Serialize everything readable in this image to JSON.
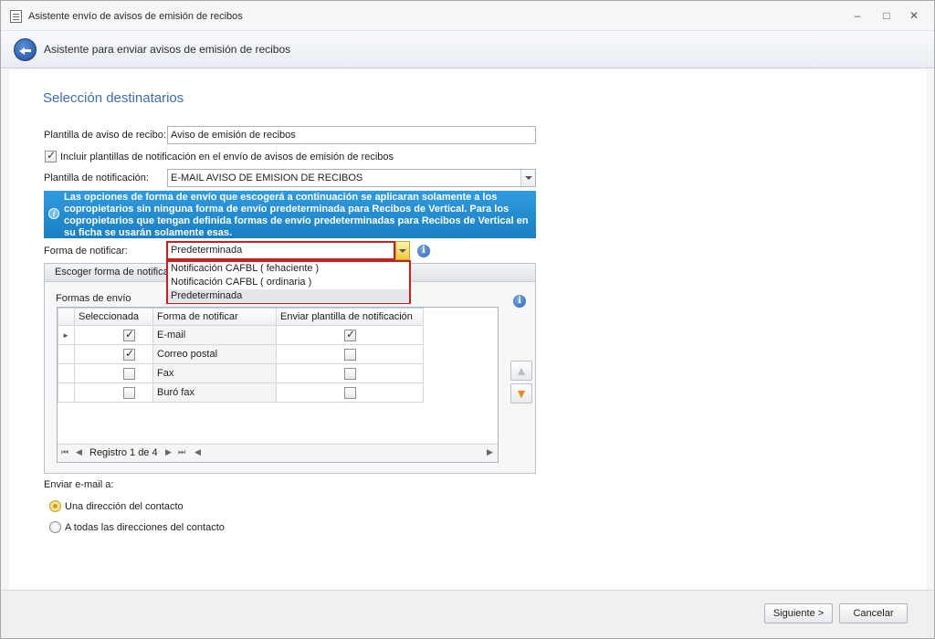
{
  "window": {
    "title": "Asistente envío de avisos de emisión de recibos",
    "controls": [
      "–",
      "□",
      "✕"
    ]
  },
  "header": {
    "title": "Asistente para enviar avisos de emisión de recibos"
  },
  "page": {
    "section_title": "Selección destinatarios",
    "plantilla_aviso_label": "Plantilla de aviso de recibo:",
    "plantilla_aviso_value": "Aviso de emisión de recibos",
    "incluir_label": "Incluir plantillas de notificación en el envío de avisos de emisión de recibos",
    "incluir_checked": true,
    "plantilla_notif_label": "Plantilla de notificación:",
    "plantilla_notif_value": "E-MAIL AVISO DE EMISION DE RECIBOS",
    "info_text": "Las opciones de forma de envío que escogerá a continuación se aplicaran solamente a los copropietarios sin ninguna forma de envío predeterminada para Recibos de Vertical. Para los copropietarios que tengan definida formas de envío predeterminadas para Recibos de Vertical en su ficha se usarán solamente esas.",
    "forma_notificar_label": "Forma de notificar:",
    "forma_notificar_value": "Predeterminada",
    "dropdown_options": [
      "Notificación CAFBL ( fehaciente )",
      "Notificación CAFBL ( ordinaria )",
      "Predeterminada"
    ],
    "dropdown_selected": "Predeterminada"
  },
  "group": {
    "header": "Escoger forma de notificar",
    "formas_label": "Formas de envío",
    "columns": [
      "Seleccionada",
      "Forma de notificar",
      "Enviar plantilla de notificación"
    ],
    "rows": [
      {
        "selected": true,
        "forma": "E-mail",
        "enviar": true
      },
      {
        "selected": true,
        "forma": "Correo postal",
        "enviar": false
      },
      {
        "selected": false,
        "forma": "Fax",
        "enviar": false
      },
      {
        "selected": false,
        "forma": "Buró fax",
        "enviar": false
      }
    ],
    "navigator_text": "Registro 1 de 4"
  },
  "email": {
    "label": "Enviar e-mail a:",
    "options": [
      "Una dirección del contacto",
      "A todas las direcciones del contacto"
    ],
    "selected_index": 0
  },
  "footer": {
    "next_label": "Siguiente >",
    "cancel_label": "Cancelar"
  },
  "colors": {
    "accent": "#3a6fb5",
    "banner": "#1a7fc4",
    "highlight_border": "#d01c1c"
  }
}
